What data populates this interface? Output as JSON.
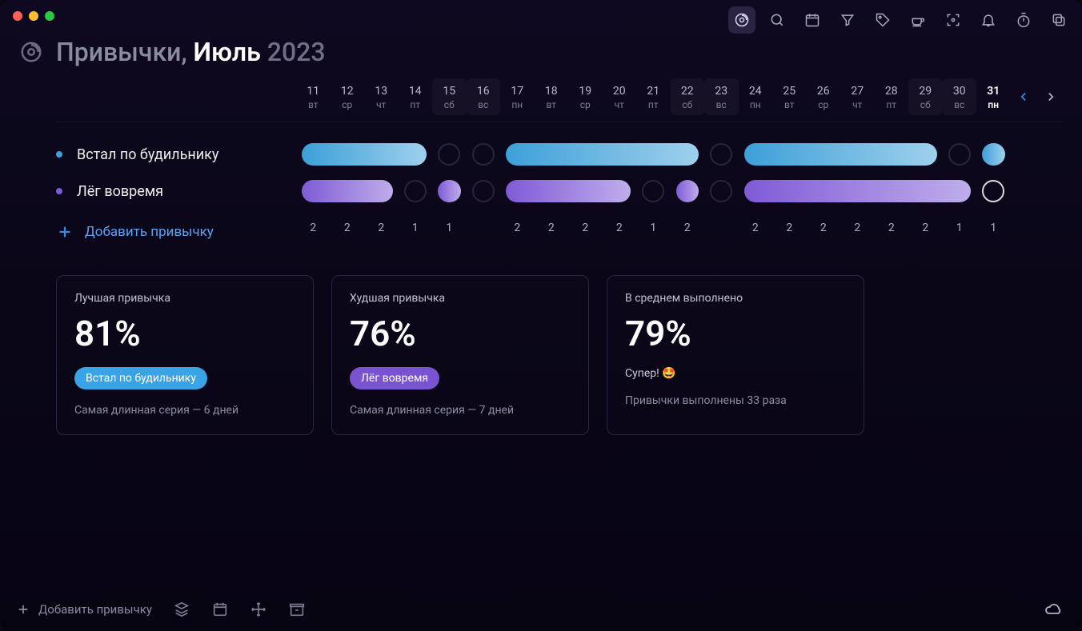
{
  "title": {
    "prefix": "Привычки, ",
    "month": "Июль",
    "year": " 2023"
  },
  "days": [
    {
      "n": "11",
      "d": "вт",
      "hl": false,
      "today": false
    },
    {
      "n": "12",
      "d": "ср",
      "hl": false,
      "today": false
    },
    {
      "n": "13",
      "d": "чт",
      "hl": false,
      "today": false
    },
    {
      "n": "14",
      "d": "пт",
      "hl": false,
      "today": false
    },
    {
      "n": "15",
      "d": "сб",
      "hl": true,
      "today": false
    },
    {
      "n": "16",
      "d": "вс",
      "hl": true,
      "today": false
    },
    {
      "n": "17",
      "d": "пн",
      "hl": false,
      "today": false
    },
    {
      "n": "18",
      "d": "вт",
      "hl": false,
      "today": false
    },
    {
      "n": "19",
      "d": "ср",
      "hl": false,
      "today": false
    },
    {
      "n": "20",
      "d": "чт",
      "hl": false,
      "today": false
    },
    {
      "n": "21",
      "d": "пт",
      "hl": false,
      "today": false
    },
    {
      "n": "22",
      "d": "сб",
      "hl": true,
      "today": false
    },
    {
      "n": "23",
      "d": "вс",
      "hl": true,
      "today": false
    },
    {
      "n": "24",
      "d": "пн",
      "hl": false,
      "today": false
    },
    {
      "n": "25",
      "d": "вт",
      "hl": false,
      "today": false
    },
    {
      "n": "26",
      "d": "ср",
      "hl": false,
      "today": false
    },
    {
      "n": "27",
      "d": "чт",
      "hl": false,
      "today": false
    },
    {
      "n": "28",
      "d": "пт",
      "hl": false,
      "today": false
    },
    {
      "n": "29",
      "d": "сб",
      "hl": true,
      "today": false
    },
    {
      "n": "30",
      "d": "вс",
      "hl": true,
      "today": false
    },
    {
      "n": "31",
      "d": "пн",
      "hl": false,
      "today": true
    }
  ],
  "habits": [
    {
      "name": "Встал по будильнику",
      "color": "#3da0d8",
      "states": [
        "f",
        "f",
        "f",
        "f",
        "e",
        "e",
        "f",
        "f",
        "f",
        "f",
        "f",
        "f",
        "e",
        "f",
        "f",
        "f",
        "f",
        "f",
        "f",
        "e",
        "f"
      ]
    },
    {
      "name": "Лёг вовремя",
      "color": "#7e5bd6",
      "states": [
        "f",
        "f",
        "f",
        "e",
        "f",
        "e",
        "f",
        "f",
        "f",
        "f",
        "e",
        "f",
        "e",
        "f",
        "f",
        "f",
        "f",
        "f",
        "f",
        "f",
        "r"
      ]
    }
  ],
  "counts": [
    "2",
    "2",
    "2",
    "1",
    "1",
    "",
    "2",
    "2",
    "2",
    "2",
    "1",
    "2",
    "",
    "2",
    "2",
    "2",
    "2",
    "2",
    "2",
    "1",
    "1"
  ],
  "add_label": "Добавить привычку",
  "stats": [
    {
      "label": "Лучшая привычка",
      "value": "81%",
      "chip": "Встал по будильнику",
      "chipColor": "#3aa3e6",
      "foot": "Самая длинная серия — 6 дней"
    },
    {
      "label": "Худшая привычка",
      "value": "76%",
      "chip": "Лёг вовремя",
      "chipColor": "#7a54d0",
      "foot": "Самая длинная серия — 7 дней"
    },
    {
      "label": "В среднем выполнено",
      "value": "79%",
      "sub": "Супер! 🤩",
      "foot": "Привычки выполнены 33 раза"
    }
  ],
  "bottom_add": "Добавить привычку",
  "chart_data": {
    "type": "table",
    "title": "Habit completion Jul 11–31 2023",
    "categories": [
      "11",
      "12",
      "13",
      "14",
      "15",
      "16",
      "17",
      "18",
      "19",
      "20",
      "21",
      "22",
      "23",
      "24",
      "25",
      "26",
      "27",
      "28",
      "29",
      "30",
      "31"
    ],
    "series": [
      {
        "name": "Встал по будильнику",
        "values": [
          1,
          1,
          1,
          1,
          0,
          0,
          1,
          1,
          1,
          1,
          1,
          1,
          0,
          1,
          1,
          1,
          1,
          1,
          1,
          0,
          1
        ]
      },
      {
        "name": "Лёг вовремя",
        "values": [
          1,
          1,
          1,
          0,
          1,
          0,
          1,
          1,
          1,
          1,
          0,
          1,
          0,
          1,
          1,
          1,
          1,
          1,
          1,
          1,
          null
        ]
      }
    ],
    "daily_total": [
      2,
      2,
      2,
      1,
      1,
      0,
      2,
      2,
      2,
      2,
      1,
      2,
      0,
      2,
      2,
      2,
      2,
      2,
      2,
      1,
      1
    ]
  }
}
